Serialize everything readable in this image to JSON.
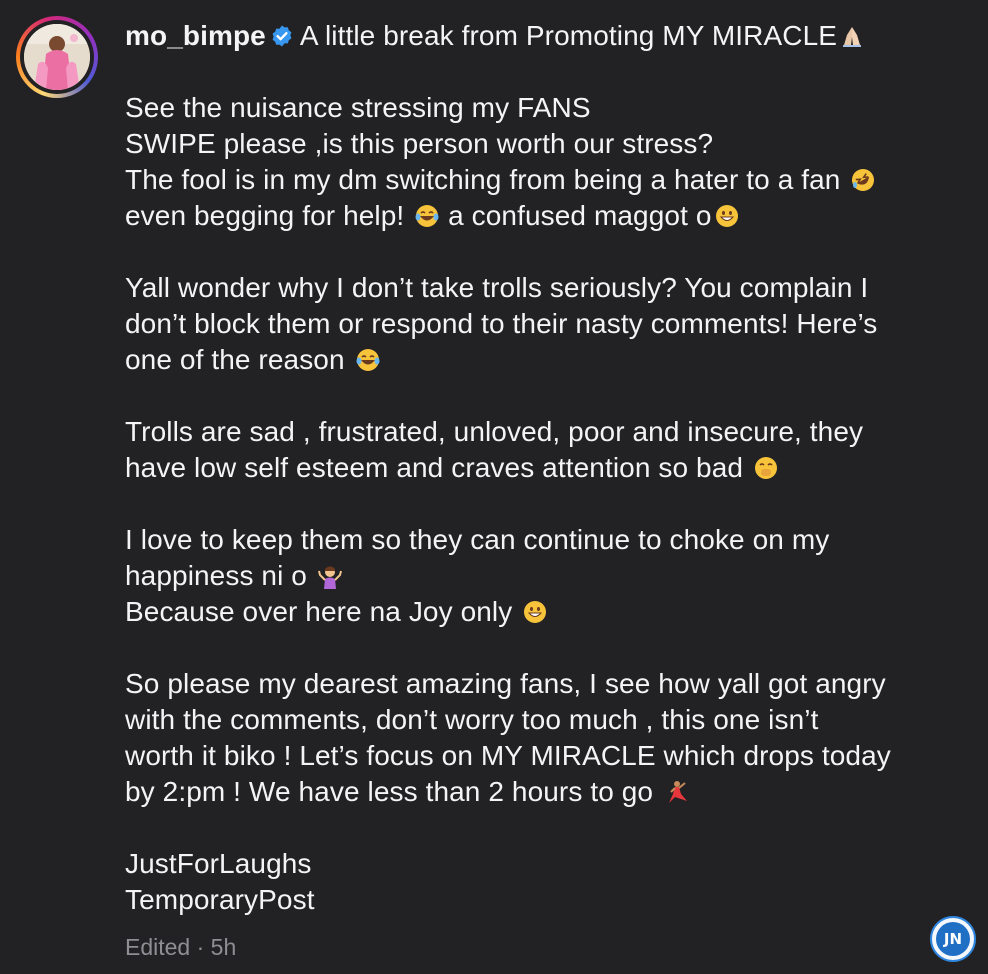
{
  "post": {
    "username": "mo_bimpe",
    "verified": true,
    "caption_first_line": "A little break from Promoting MY MIRACLE",
    "lines": {
      "l1": "See the nuisance stressing my FANS",
      "l2": "SWIPE please ,is this person worth our stress?",
      "l3": "The fool is in my dm switching from being a hater to a fan",
      "l4a": "even begging for help!",
      "l4b": "a confused maggot o",
      "l5": "Yall wonder why I don’t take trolls seriously? You complain I",
      "l6": "don’t block them or respond to their nasty comments! Here’s",
      "l7": "one of the reason",
      "l8": "Trolls are sad , frustrated, unloved, poor and insecure, they",
      "l9": "have low self esteem and craves attention so bad",
      "l10": "I love to keep them so they can continue to choke on my",
      "l11": "happiness ni o",
      "l12": "Because over here na Joy only",
      "l13": "So please my dearest amazing fans, I see how yall got angry",
      "l14": "with the comments, don’t worry too much , this one isn’t",
      "l15": "worth it biko ! Let’s focus on MY MIRACLE which drops today",
      "l16": "by 2:pm ! We have less than 2 hours to go",
      "l17": "JustForLaughs",
      "l18": "TemporaryPost"
    },
    "meta": "Edited · 5h"
  },
  "watermark": {
    "text": "JN"
  },
  "icons": {
    "verified": "verified-badge-icon",
    "pray": "folded-hands-emoji",
    "rofl": "rolling-laughing-emoji",
    "joy": "tears-of-joy-emoji",
    "grin": "grinning-face-emoji",
    "hand_over_mouth": "face-with-hand-over-mouth-emoji",
    "shrug": "person-shrugging-emoji",
    "dancer": "woman-dancing-emoji"
  },
  "colors": {
    "background": "#222225",
    "text": "#f4f4f5",
    "meta": "#8e8e93",
    "verified": "#3897f0"
  }
}
